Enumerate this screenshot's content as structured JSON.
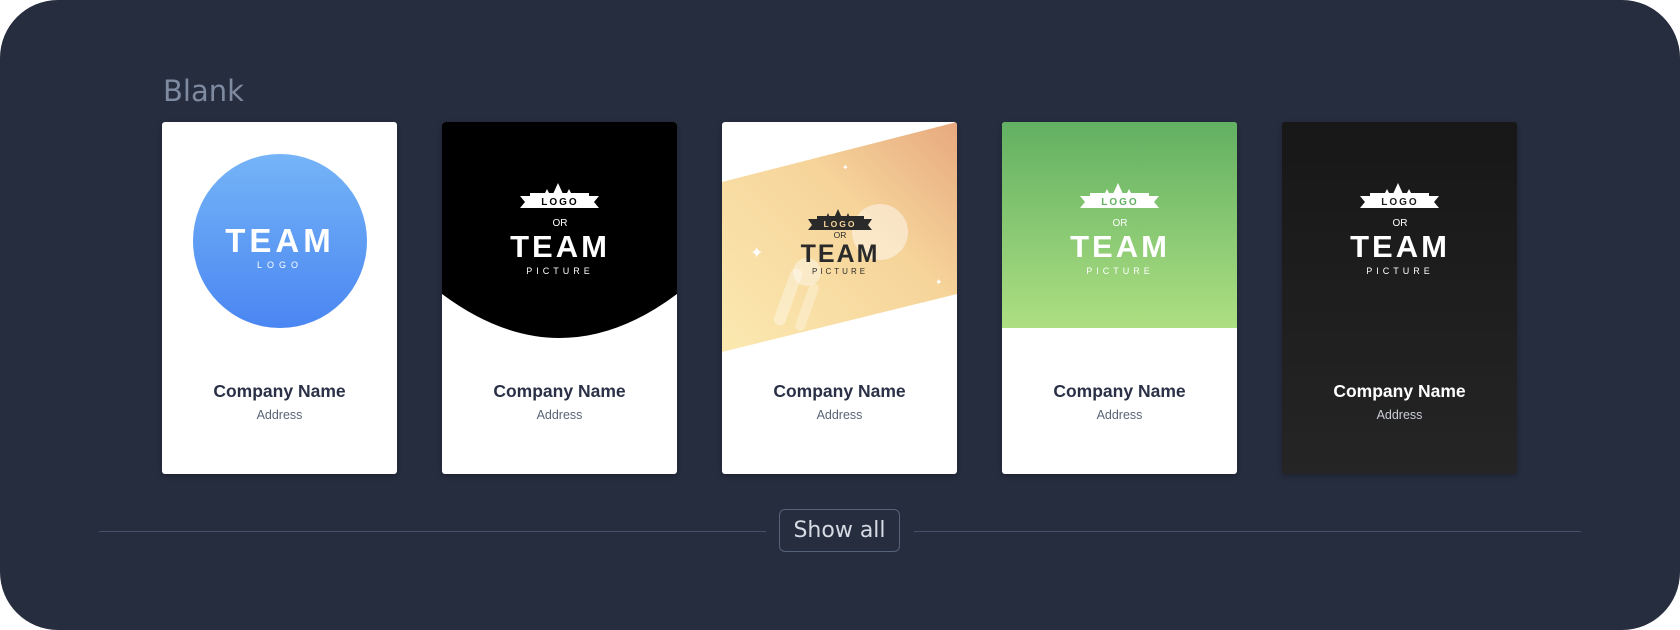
{
  "section": {
    "title": "Blank"
  },
  "templates": [
    {
      "style": "blue-circle",
      "logo_lines": [
        "TEAM",
        "LOGO"
      ],
      "company_name": "Company Name",
      "address": "Address",
      "colors": {
        "circle_top": "#75b4f7",
        "circle_bottom": "#4a86f2"
      }
    },
    {
      "style": "black-arc",
      "logo_lines": [
        "LOGO",
        "OR",
        "TEAM",
        "PICTURE"
      ],
      "company_name": "Company Name",
      "address": "Address",
      "colors": {
        "header": "#000000"
      }
    },
    {
      "style": "diagonal-gradient",
      "logo_lines": [
        "LOGO",
        "OR",
        "TEAM",
        "PICTURE"
      ],
      "company_name": "Company Name",
      "address": "Address",
      "colors": {
        "gradient_left": "#fbe9b0",
        "gradient_right": "#e7a97e"
      }
    },
    {
      "style": "green-gradient",
      "logo_lines": [
        "LOGO",
        "OR",
        "TEAM",
        "PICTURE"
      ],
      "company_name": "Company Name",
      "address": "Address",
      "colors": {
        "gradient_top": "#62b062",
        "gradient_bottom": "#addf82"
      }
    },
    {
      "style": "dark",
      "logo_lines": [
        "LOGO",
        "OR",
        "TEAM",
        "PICTURE"
      ],
      "company_name": "Company Name",
      "address": "Address",
      "colors": {
        "background": "#1c1c1c"
      }
    }
  ],
  "show_all_label": "Show all",
  "colors": {
    "panel": "#262d3f",
    "title": "#7e8aa0",
    "divider": "#46506a"
  }
}
